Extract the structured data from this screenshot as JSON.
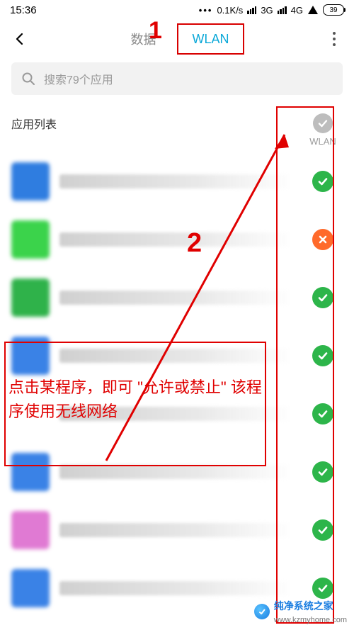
{
  "status": {
    "time": "15:36",
    "speed": "0.1K/s",
    "net1_label": "3G",
    "net2_label": "4G",
    "battery_pct": "39"
  },
  "nav": {
    "tab_data": "数据",
    "tab_wlan": "WLAN"
  },
  "search": {
    "placeholder": "搜索79个应用"
  },
  "listheader": {
    "title": "应用列表",
    "column_label": "WLAN"
  },
  "apps": [
    {
      "icon_color": "#2f7de0",
      "status": "allow"
    },
    {
      "icon_color": "#3bd34b",
      "status": "deny"
    },
    {
      "icon_color": "#2fb24a",
      "status": "allow"
    },
    {
      "icon_color": "#3a82e6",
      "status": "allow"
    },
    {
      "icon_color": "#ffffff",
      "status": "allow"
    },
    {
      "icon_color": "#3a82e6",
      "status": "allow"
    },
    {
      "icon_color": "#e07ad3",
      "status": "allow"
    },
    {
      "icon_color": "#3a82e6",
      "status": "allow"
    }
  ],
  "annotations": {
    "num1": "1",
    "num2": "2",
    "tip": "点击某程序，即可 \"允许或禁止\" 该程序使用无线网络"
  },
  "watermark": {
    "name": "纯净系统之家",
    "url": "www.kzmyhome.com"
  }
}
